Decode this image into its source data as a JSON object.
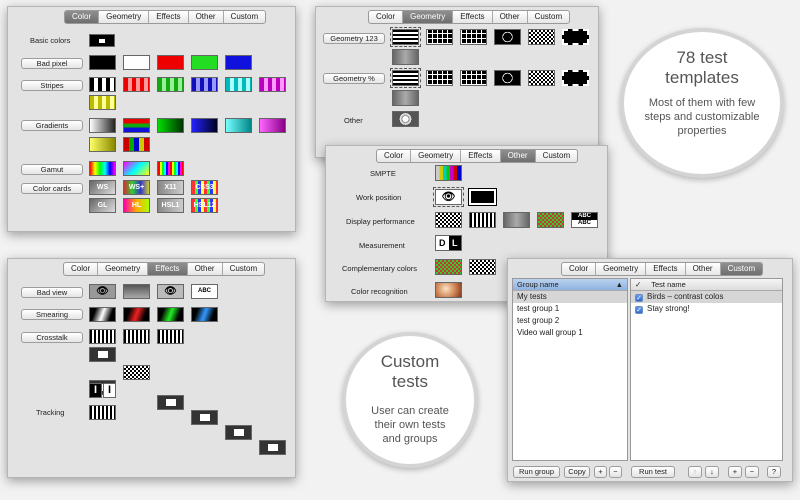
{
  "color_panel": {
    "tabs": [
      "Color",
      "Geometry",
      "Effects",
      "Other",
      "Custom"
    ],
    "active_tab": "Color",
    "basic_colors_label": "Basic colors",
    "buttons": [
      "Bad pixel",
      "Stripes",
      "Gradients",
      "Gamut",
      "Color cards"
    ],
    "color_cards": [
      "WS",
      "WS+",
      "X11",
      "CSS3",
      "GL",
      "HL",
      "HSL1",
      "HSL12"
    ]
  },
  "geometry_panel": {
    "tabs": [
      "Color",
      "Geometry",
      "Effects",
      "Other",
      "Custom"
    ],
    "active_tab": "Geometry",
    "buttons": [
      "Geometry 123",
      "Geometry %"
    ],
    "other_label": "Other"
  },
  "other_panel": {
    "tabs": [
      "Color",
      "Geometry",
      "Effects",
      "Other",
      "Custom"
    ],
    "active_tab": "Other",
    "labels": [
      "SMPTE",
      "Work position",
      "Display performance",
      "Measurement",
      "Complementary colors",
      "Color recognition"
    ],
    "abc_text": "ABC",
    "dl_d": "D",
    "dl_l": "L"
  },
  "effects_panel": {
    "tabs": [
      "Color",
      "Geometry",
      "Effects",
      "Other",
      "Custom"
    ],
    "active_tab": "Effects",
    "buttons": [
      "Bad view",
      "Smearing",
      "Crosstalk"
    ],
    "tracking_label": "Tracking",
    "abc_text": "ABC",
    "i_glyph": "I"
  },
  "custom_panel": {
    "tabs": [
      "Color",
      "Geometry",
      "Effects",
      "Other",
      "Custom"
    ],
    "active_tab": "Custom",
    "group_header": "Group name",
    "groups": [
      "My tests",
      "test group 1",
      "test group 2",
      "Video wall group 1"
    ],
    "test_header": "Test name",
    "test_header_check": "✓",
    "tests": [
      {
        "name": "Birds – contrast colos",
        "checked": true
      },
      {
        "name": "Stay strong!",
        "checked": true
      }
    ],
    "buttons": {
      "run_group": "Run group",
      "copy": "Copy",
      "plus": "+",
      "minus": "−",
      "run_test": "Run test",
      "up": "↑",
      "down": "↓",
      "plus2": "+",
      "minus2": "−",
      "help": "?"
    }
  },
  "callout_templates": {
    "title": "78 test templates",
    "body": "Most of them with few steps and customizable properties"
  },
  "callout_custom": {
    "title": "Custom tests",
    "body": "User can create their own tests and groups"
  }
}
